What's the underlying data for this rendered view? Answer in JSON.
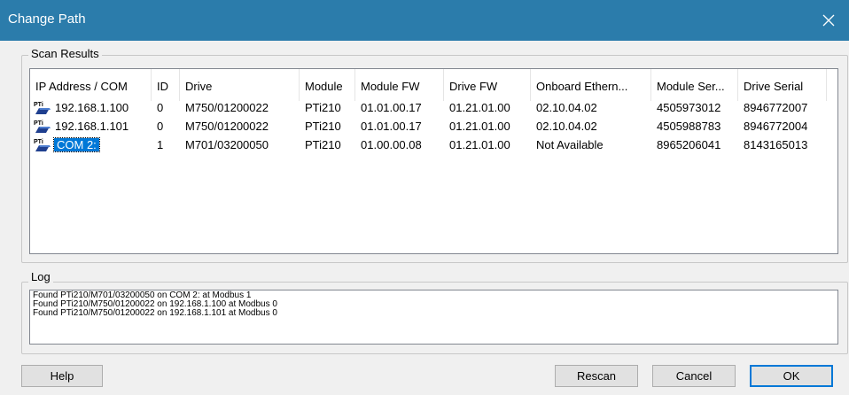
{
  "window": {
    "title": "Change Path"
  },
  "scan_results": {
    "label": "Scan Results",
    "columns": [
      "IP Address / COM",
      "ID",
      "Drive",
      "Module",
      "Module FW",
      "Drive FW",
      "Onboard Ethern...",
      "Module Ser...",
      "Drive Serial"
    ],
    "rows": [
      {
        "icon": "pti-icon",
        "icon_text": "PTi",
        "address": "192.168.1.100",
        "id": "0",
        "drive": "M750/01200022",
        "module": "PTi210",
        "module_fw": "01.01.00.17",
        "drive_fw": "01.21.01.00",
        "onboard_ethernet": "02.10.04.02",
        "module_serial": "4505973012",
        "drive_serial": "8946772007",
        "selected": false
      },
      {
        "icon": "pti-icon",
        "icon_text": "PTi",
        "address": "192.168.1.101",
        "id": "0",
        "drive": "M750/01200022",
        "module": "PTi210",
        "module_fw": "01.01.00.17",
        "drive_fw": "01.21.01.00",
        "onboard_ethernet": "02.10.04.02",
        "module_serial": "4505988783",
        "drive_serial": "8946772004",
        "selected": false
      },
      {
        "icon": "pti-icon",
        "icon_text": "PTi",
        "address": "COM 2:",
        "id": "1",
        "drive": "M701/03200050",
        "module": "PTi210",
        "module_fw": "01.00.00.08",
        "drive_fw": "01.21.01.00",
        "onboard_ethernet": "Not Available",
        "module_serial": "8965206041",
        "drive_serial": "8143165013",
        "selected": true
      }
    ]
  },
  "log": {
    "label": "Log",
    "lines": [
      "Found PTi210/M701/03200050 on COM 2: at Modbus 1",
      "Found PTi210/M750/01200022 on 192.168.1.100 at Modbus 0",
      "Found PTi210/M750/01200022 on 192.168.1.101 at Modbus 0"
    ]
  },
  "buttons": {
    "help": "Help",
    "rescan": "Rescan",
    "cancel": "Cancel",
    "ok": "OK"
  },
  "colors": {
    "titlebar": "#2b7cab",
    "selection": "#0078d7",
    "default_button_border": "#0078d7"
  },
  "icons": {
    "close": "close-icon",
    "row": "pti-icon"
  }
}
